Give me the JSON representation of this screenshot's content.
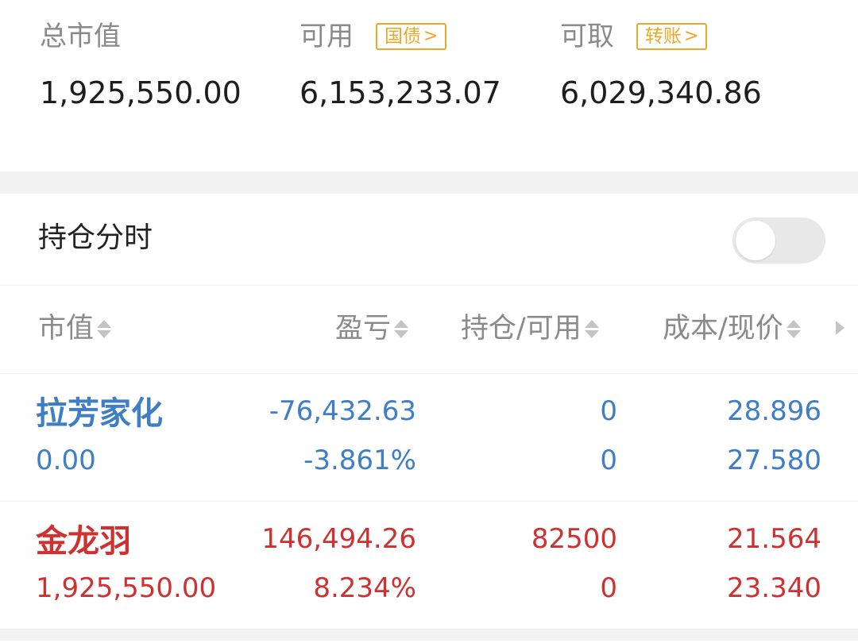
{
  "summary": {
    "market_value": {
      "label": "总市值",
      "value": "1,925,550.00"
    },
    "available": {
      "label": "可用",
      "tag": "国债",
      "value": "6,153,233.07"
    },
    "withdrawable": {
      "label": "可取",
      "tag": "转账",
      "value": "6,029,340.86"
    }
  },
  "toggle": {
    "label": "持仓分时",
    "enabled": false
  },
  "table": {
    "headers": [
      "市值",
      "盈亏",
      "持仓/可用",
      "成本/现价"
    ],
    "rows": [
      {
        "name": "拉芳家化",
        "market_value": "0.00",
        "pnl": "-76,432.63",
        "pnl_pct": "-3.861%",
        "position": "0",
        "available": "0",
        "cost": "28.896",
        "price": "27.580",
        "color": "#3d7ec6"
      },
      {
        "name": "金龙羽",
        "market_value": "1,925,550.00",
        "pnl": "146,494.26",
        "pnl_pct": "8.234%",
        "position": "82500",
        "available": "0",
        "cost": "21.564",
        "price": "23.340",
        "color": "#cf3030"
      }
    ]
  },
  "colors": {
    "accent_tag": "#e9a825",
    "gain": "#cf3030",
    "loss": "#3d7ec6"
  }
}
